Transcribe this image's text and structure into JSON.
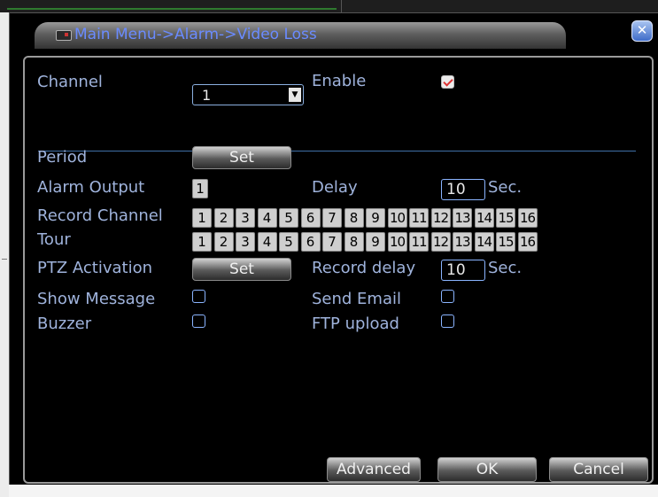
{
  "window": {
    "title": "Main Menu->Alarm->Video Loss"
  },
  "form": {
    "channel_label": "Channel",
    "channel_value": "1",
    "enable_label": "Enable",
    "enable_checked": true,
    "period_label": "Period",
    "period_button": "Set",
    "alarm_output_label": "Alarm Output",
    "alarm_output_value": "1",
    "delay_label": "Delay",
    "delay_value": "10",
    "delay_unit": "Sec.",
    "record_channel_label": "Record Channel",
    "record_channels": [
      "1",
      "2",
      "3",
      "4",
      "5",
      "6",
      "7",
      "8",
      "9",
      "10",
      "11",
      "12",
      "13",
      "14",
      "15",
      "16"
    ],
    "tour_label": "Tour",
    "tour_channels": [
      "1",
      "2",
      "3",
      "4",
      "5",
      "6",
      "7",
      "8",
      "9",
      "10",
      "11",
      "12",
      "13",
      "14",
      "15",
      "16"
    ],
    "ptz_label": "PTZ Activation",
    "ptz_button": "Set",
    "record_delay_label": "Record delay",
    "record_delay_value": "10",
    "record_delay_unit": "Sec.",
    "show_message_label": "Show Message",
    "show_message_checked": false,
    "send_email_label": "Send Email",
    "send_email_checked": false,
    "buzzer_label": "Buzzer",
    "buzzer_checked": false,
    "ftp_upload_label": "FTP upload",
    "ftp_upload_checked": false
  },
  "buttons": {
    "advanced": "Advanced",
    "ok": "OK",
    "cancel": "Cancel"
  },
  "icons": {
    "title_icon": "camera-icon",
    "close_icon": "close-icon",
    "dropdown_icon": "chevron-down-icon"
  },
  "colors": {
    "label_text": "#9fb3dc",
    "title_text": "#6a8bff",
    "separator": "#3f6fa8",
    "check_mark": "#dd3333"
  }
}
